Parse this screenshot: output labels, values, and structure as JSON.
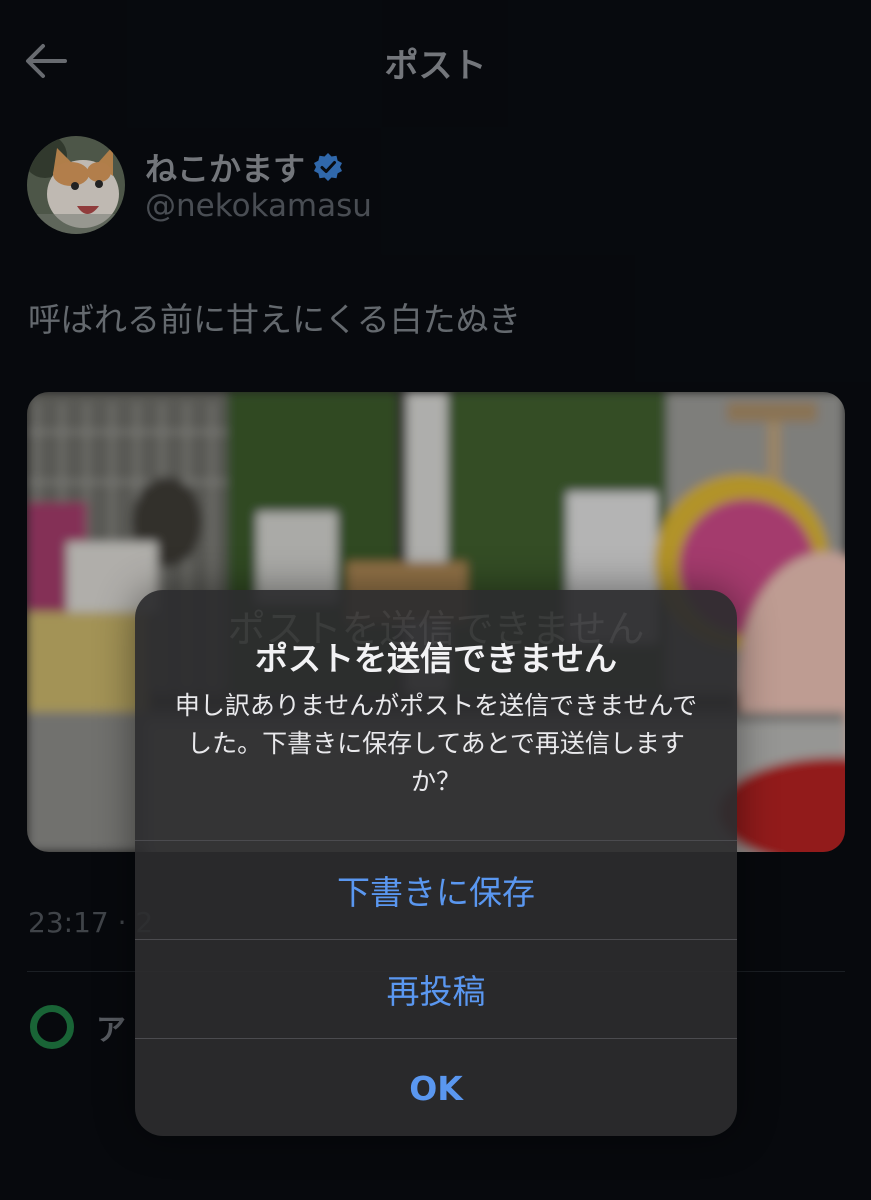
{
  "header": {
    "title": "ポスト",
    "back_icon": "arrow-left-icon"
  },
  "author": {
    "display_name": "ねこかます",
    "handle": "@nekokamasu",
    "verified_icon": "verified-badge-icon",
    "verified_color": "#3b7fd1"
  },
  "post": {
    "text": "呼ばれる前に甘えにくる白たぬき",
    "timestamp": "23:17 · 2"
  },
  "status": {
    "label": "ア",
    "color": "#1f7a43"
  },
  "alert": {
    "title": "ポストを送信できません",
    "message": "申し訳ありませんがポストを送信できませんでした。下書きに保存してあとで再送信しますか？",
    "buttons": {
      "save_draft": "下書きに保存",
      "retry": "再投稿",
      "ok": "OK"
    },
    "accent_color": "#5a97f0"
  }
}
